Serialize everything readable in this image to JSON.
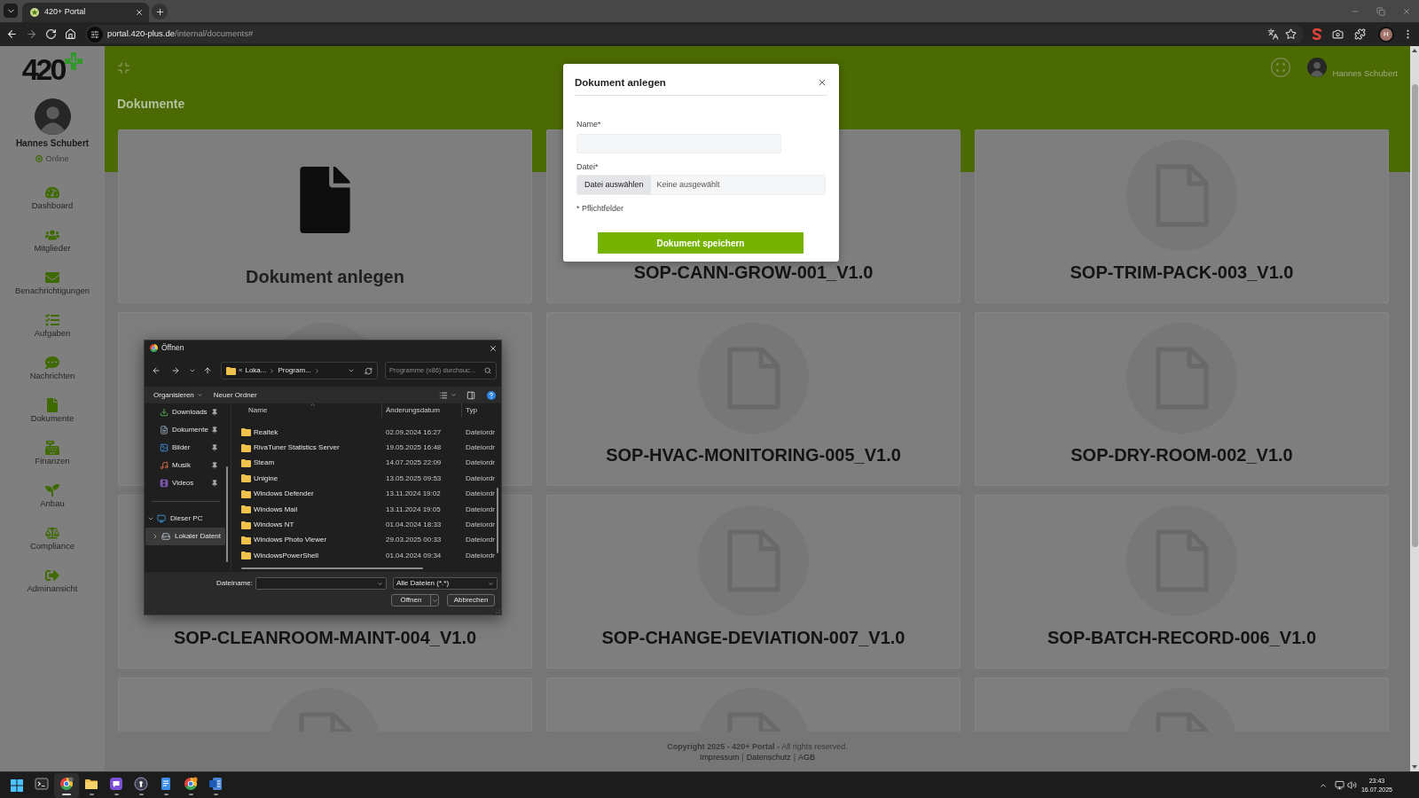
{
  "browser": {
    "tab": {
      "title": "420+ Portal"
    },
    "url": {
      "host": "portal.420-plus.de",
      "path": "/internal/documents#"
    },
    "profile_initial": "H"
  },
  "sidebar": {
    "logo": "420",
    "user": {
      "name": "Hannes Schubert",
      "status": "Online"
    },
    "items": [
      {
        "label": "Dashboard"
      },
      {
        "label": "Mitglieder"
      },
      {
        "label": "Benachrichtigungen"
      },
      {
        "label": "Aufgaben"
      },
      {
        "label": "Nachrichten"
      },
      {
        "label": "Dokumente"
      },
      {
        "label": "Finanzen"
      },
      {
        "label": "Anbau"
      },
      {
        "label": "Compliance"
      },
      {
        "label": "Adminansicht"
      }
    ]
  },
  "header": {
    "title": "Dokumente",
    "user_name": "Hannes Schubert"
  },
  "documents": [
    {
      "kind": "new",
      "title": "Dokument anlegen"
    },
    {
      "kind": "document",
      "title": "SOP-CANN-GROW-001_V1.0"
    },
    {
      "kind": "document",
      "title": "SOP-TRIM-PACK-003_V1.0"
    },
    {
      "kind": "document"
    },
    {
      "kind": "document",
      "title": "SOP-HVAC-MONITORING-005_V1.0"
    },
    {
      "kind": "document",
      "title": "SOP-DRY-ROOM-002_V1.0"
    },
    {
      "kind": "document",
      "title": "SOP-CLEANROOM-MAINT-004_V1.0"
    },
    {
      "kind": "document",
      "title": "SOP-CHANGE-DEVIATION-007_V1.0"
    },
    {
      "kind": "document",
      "title": "SOP-BATCH-RECORD-006_V1.0"
    },
    {
      "kind": "document"
    },
    {
      "kind": "document"
    },
    {
      "kind": "document"
    }
  ],
  "footer": {
    "copyright": "**Copyright 2025 - 420+ Portal -** All rights reserved.",
    "links": [
      "Impressum",
      "Datenschutz",
      "AGB"
    ],
    "separator": "|"
  },
  "modal": {
    "title": "Dokument anlegen",
    "name_field": {
      "label": "Name*"
    },
    "file_field": {
      "label": "Datei*",
      "button": "Datei auswählen",
      "value": "Keine ausgewählt"
    },
    "note": "* Pflichtfelder",
    "submit": "Dokument speichern"
  },
  "file_dialog": {
    "title": "Öffnen",
    "path_overflow": "«",
    "path": [
      "Loka...",
      "Program..."
    ],
    "search": {
      "placeholder": "Programme (x86) durchsuc..."
    },
    "toolbar": {
      "organize": "Organisieren",
      "new_folder": "Neuer Ordner"
    },
    "quick_access": [
      {
        "label": "Downloads",
        "pinned": true,
        "selected": false
      },
      {
        "label": "Dokumente",
        "pinned": true,
        "selected": false
      },
      {
        "label": "Bilder",
        "pinned": true,
        "selected": false
      },
      {
        "label": "Musik",
        "pinned": true,
        "selected": false
      },
      {
        "label": "Videos",
        "pinned": true,
        "selected": false
      }
    ],
    "tree": [
      {
        "label": "Dieser PC",
        "expanded": true,
        "selected": false,
        "children": [
          {
            "label": "Lokaler Datent",
            "expanded": false,
            "selected": true
          }
        ]
      }
    ],
    "columns": [
      "Name",
      "Änderungsdatum",
      "Typ"
    ],
    "rows": [
      {
        "name": "Realtek",
        "modified": "02.09.2024 16:27",
        "type": "Dateiordr"
      },
      {
        "name": "RivaTuner Statistics Server",
        "modified": "19.05.2025 16:48",
        "type": "Dateiordr"
      },
      {
        "name": "Steam",
        "modified": "14.07.2025 22:09",
        "type": "Dateiordr"
      },
      {
        "name": "Unigine",
        "modified": "13.05.2025 09:53",
        "type": "Dateiordr"
      },
      {
        "name": "Windows Defender",
        "modified": "13.11.2024 19:02",
        "type": "Dateiordr"
      },
      {
        "name": "Windows Mail",
        "modified": "13.11.2024 19:05",
        "type": "Dateiordr"
      },
      {
        "name": "Windows NT",
        "modified": "01.04.2024 18:33",
        "type": "Dateiordr"
      },
      {
        "name": "Windows Photo Viewer",
        "modified": "29.03.2025 00:33",
        "type": "Dateiordr"
      },
      {
        "name": "WindowsPowerShell",
        "modified": "01.04.2024 09:34",
        "type": "Dateiordr"
      }
    ],
    "filename": {
      "label": "Dateiname:"
    },
    "filter": "Alle Dateien (*.*)",
    "buttons": {
      "open": "Öffnen",
      "cancel": "Abbrechen"
    }
  },
  "taskbar": {
    "apps": [
      {
        "running": false,
        "active": false
      },
      {
        "running": true,
        "active": true
      },
      {
        "running": true,
        "active": false
      },
      {
        "running": true,
        "active": false
      },
      {
        "running": true,
        "active": false
      },
      {
        "running": true,
        "active": false
      },
      {
        "running": true,
        "active": false
      },
      {
        "running": true,
        "active": false
      }
    ],
    "time": "23:43",
    "date": "16.07.2025"
  }
}
